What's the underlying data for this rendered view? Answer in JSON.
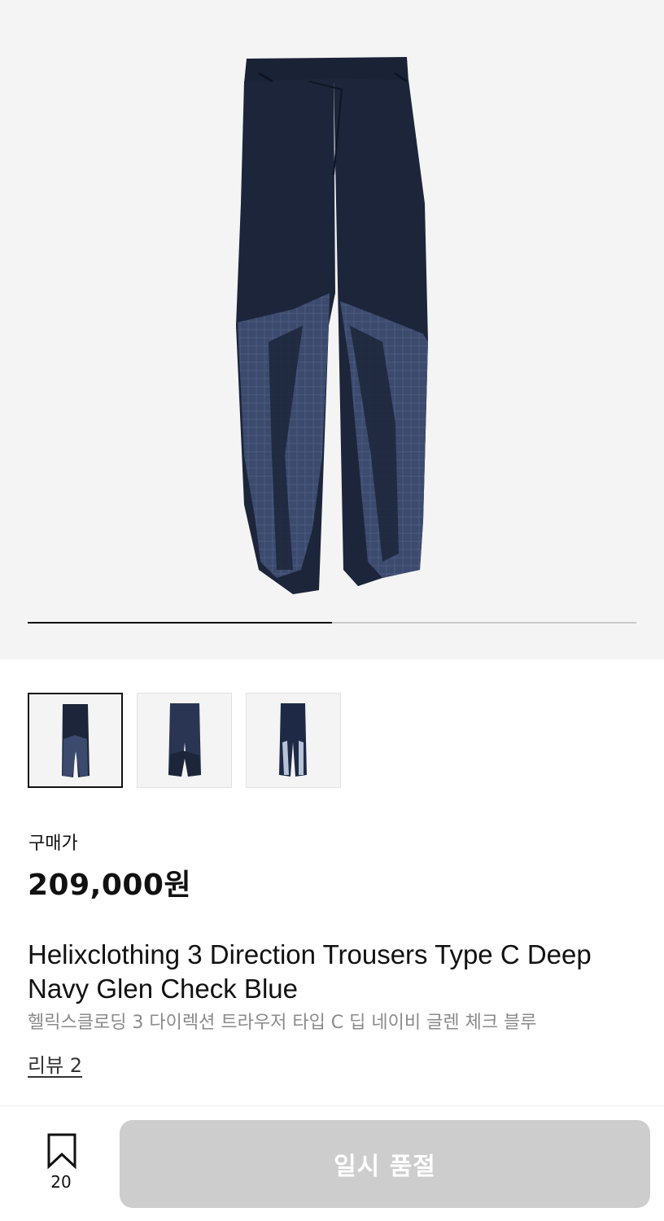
{
  "gallery": {
    "current_index": 1,
    "total": 2,
    "thumbnails": [
      {
        "label": "thumbnail-1",
        "active": true
      },
      {
        "label": "thumbnail-2",
        "active": false
      },
      {
        "label": "thumbnail-3",
        "active": false
      }
    ]
  },
  "product": {
    "price_label": "구매가",
    "price": "209,000원",
    "title": "Helixclothing 3 Direction Trousers Type C Deep Navy Glen Check Blue",
    "subtitle": "헬릭스클로딩 3 다이렉션 트라우저 타입 C 딥 네이비 글렌 체크 블루",
    "reviews": "리뷰 2"
  },
  "bottom_bar": {
    "bookmark_icon": "bookmark-icon",
    "bookmark_count": "20",
    "action_label": "일시 품절"
  },
  "colors": {
    "navy": "#1b2438",
    "glen_check": "#3a4a6e",
    "disabled_button": "#cdcdcd"
  }
}
